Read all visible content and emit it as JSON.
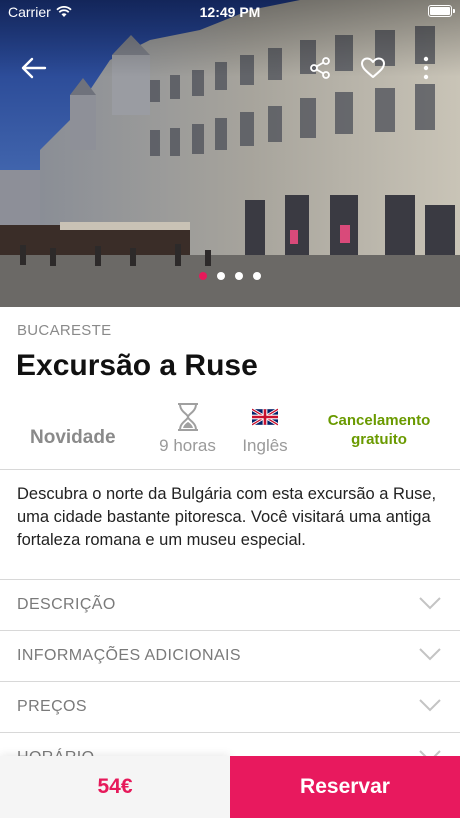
{
  "status_bar": {
    "carrier": "Carrier",
    "time": "12:49 PM"
  },
  "hero": {
    "dots_total": 4,
    "active_dot": 0
  },
  "activity": {
    "city": "BUCARESTE",
    "title": "Excursão a Ruse",
    "features": {
      "badge": "Novidade",
      "duration": "9 horas",
      "language": "Inglês",
      "cancellation": "Cancelamento gratuito"
    },
    "description": "Descubra o norte da Bulgária com esta excursão a Ruse, uma cidade bastante pitoresca. Você visitará uma antiga fortaleza romana e um museu especial."
  },
  "sections": [
    {
      "label": "DESCRIÇÃO"
    },
    {
      "label": "INFORMAÇÕES ADICIONAIS"
    },
    {
      "label": "PREÇOS"
    },
    {
      "label": "HORÁRIO"
    }
  ],
  "footer": {
    "price": "54€",
    "reserve_label": "Reservar"
  },
  "colors": {
    "accent": "#e8195e",
    "cancel_green": "#6a9a00"
  },
  "icons": [
    "back-arrow-icon",
    "share-icon",
    "heart-icon",
    "more-vertical-icon",
    "hourglass-icon",
    "uk-flag-icon",
    "chevron-down-icon"
  ]
}
